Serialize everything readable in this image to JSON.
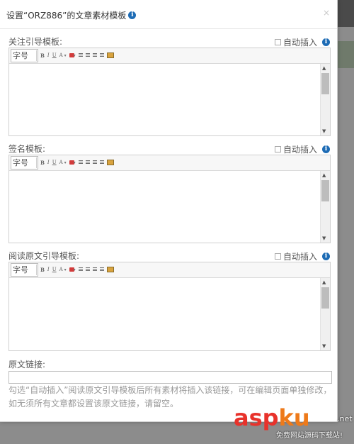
{
  "dialog": {
    "title": "设置“ORZ886”的文章素材模板",
    "close": "×"
  },
  "sections": [
    {
      "label": "关注引导模板:",
      "auto_insert": "自动插入"
    },
    {
      "label": "签名模板:",
      "auto_insert": "自动插入"
    },
    {
      "label": "阅读原文引导模板:",
      "auto_insert": "自动插入"
    }
  ],
  "toolbar": {
    "fontsize": "字号",
    "bold": "B",
    "italic": "I",
    "underline": "U",
    "fontcolor": "A"
  },
  "link": {
    "label": "原文链接:",
    "value": ""
  },
  "help_text": "勾选“自动插入”阅读原文引导模板后所有素材将插入该链接，可在编辑页面单独修改，如无须所有文章都设置该原文链接，请留空。",
  "watermark": {
    "asp": "asp",
    "ku": "ku",
    "net": ".net",
    "sub": "免费网站源码下载站!"
  },
  "colors": {
    "info_icon": "#1e6cb5",
    "watermark_red": "#e8322b",
    "watermark_orange": "#ee7a1a"
  }
}
